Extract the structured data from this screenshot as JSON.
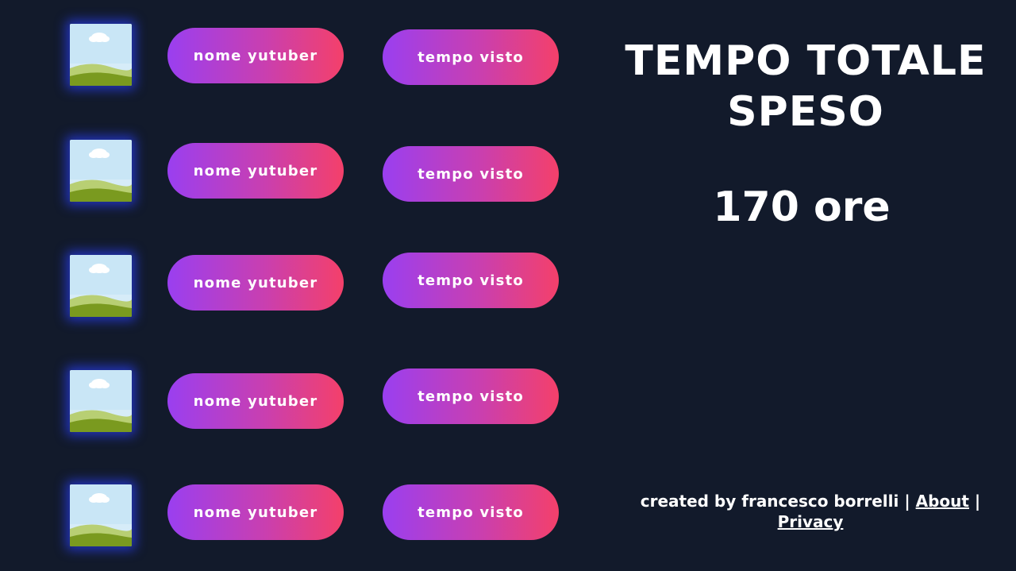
{
  "rows": [
    {
      "name_label": "nome yutuber",
      "time_label": "tempo visto",
      "thumbnail_icon": "image-placeholder-icon"
    },
    {
      "name_label": "nome yutuber",
      "time_label": "tempo visto",
      "thumbnail_icon": "image-placeholder-icon"
    },
    {
      "name_label": "nome yutuber",
      "time_label": "tempo visto",
      "thumbnail_icon": "image-placeholder-icon"
    },
    {
      "name_label": "nome yutuber",
      "time_label": "tempo visto",
      "thumbnail_icon": "image-placeholder-icon"
    },
    {
      "name_label": "nome yutuber",
      "time_label": "tempo visto",
      "thumbnail_icon": "image-placeholder-icon"
    }
  ],
  "summary": {
    "title_line1": "TEMPO TOTALE",
    "title_line2": "SPESO",
    "total": "170 ore"
  },
  "footer": {
    "credit": "created by francesco borrelli",
    "separator": "|",
    "about_label": "About",
    "privacy_label": "Privacy"
  },
  "colors": {
    "background": "#121a2b",
    "pill_gradient_start": "#9a3ff0",
    "pill_gradient_end": "#f4406a",
    "thumb_glow": "#283ce6",
    "text": "#ffffff"
  }
}
